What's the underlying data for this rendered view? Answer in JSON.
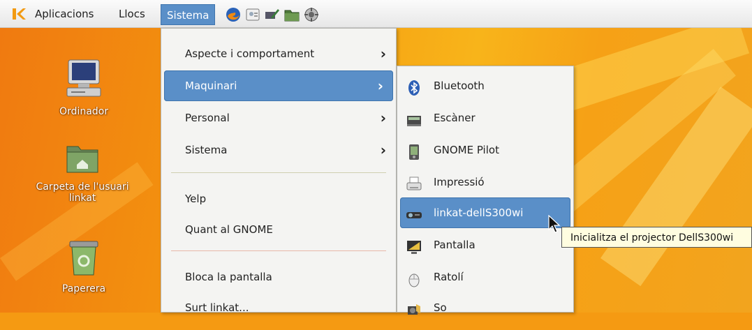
{
  "panel": {
    "menus": {
      "apps": "Aplicacions",
      "places": "Llocs",
      "system": "Sistema"
    },
    "launchers": [
      "firefox-icon",
      "contacts-icon",
      "screenshot-icon",
      "file-manager-icon",
      "settings-icon"
    ]
  },
  "desktop": {
    "icons": [
      {
        "label": "Ordinador",
        "icon": "computer-icon"
      },
      {
        "label": "Carpeta de l'usuari linkat",
        "icon": "home-folder-icon"
      },
      {
        "label": "Paperera",
        "icon": "trash-icon"
      }
    ]
  },
  "system_menu": {
    "items": [
      {
        "label": "Aspecte i comportament",
        "submenu": true
      },
      {
        "label": "Maquinari",
        "submenu": true,
        "highlighted": true
      },
      {
        "label": "Personal",
        "submenu": true
      },
      {
        "label": "Sistema",
        "submenu": true
      },
      {
        "label": "Yelp"
      },
      {
        "label": "Quant al GNOME"
      },
      {
        "label": "Bloca la pantalla"
      },
      {
        "label": "Surt linkat..."
      }
    ]
  },
  "hardware_menu": {
    "items": [
      {
        "label": "Bluetooth",
        "icon": "bluetooth-icon"
      },
      {
        "label": "Escàner",
        "icon": "scanner-icon"
      },
      {
        "label": "GNOME Pilot",
        "icon": "pda-icon"
      },
      {
        "label": "Impressió",
        "icon": "printer-icon"
      },
      {
        "label": "linkat-dellS300wi",
        "icon": "projector-icon",
        "highlighted": true
      },
      {
        "label": "Pantalla",
        "icon": "display-icon"
      },
      {
        "label": "Ratolí",
        "icon": "mouse-icon"
      },
      {
        "label": "So",
        "icon": "sound-icon"
      }
    ]
  },
  "tooltip": {
    "text": "Inicialitza el projector DellS300wi"
  },
  "colors": {
    "highlight": "#5a8fc8",
    "wallpaper": "#f59a12",
    "menu_bg": "#f4f4f2"
  }
}
